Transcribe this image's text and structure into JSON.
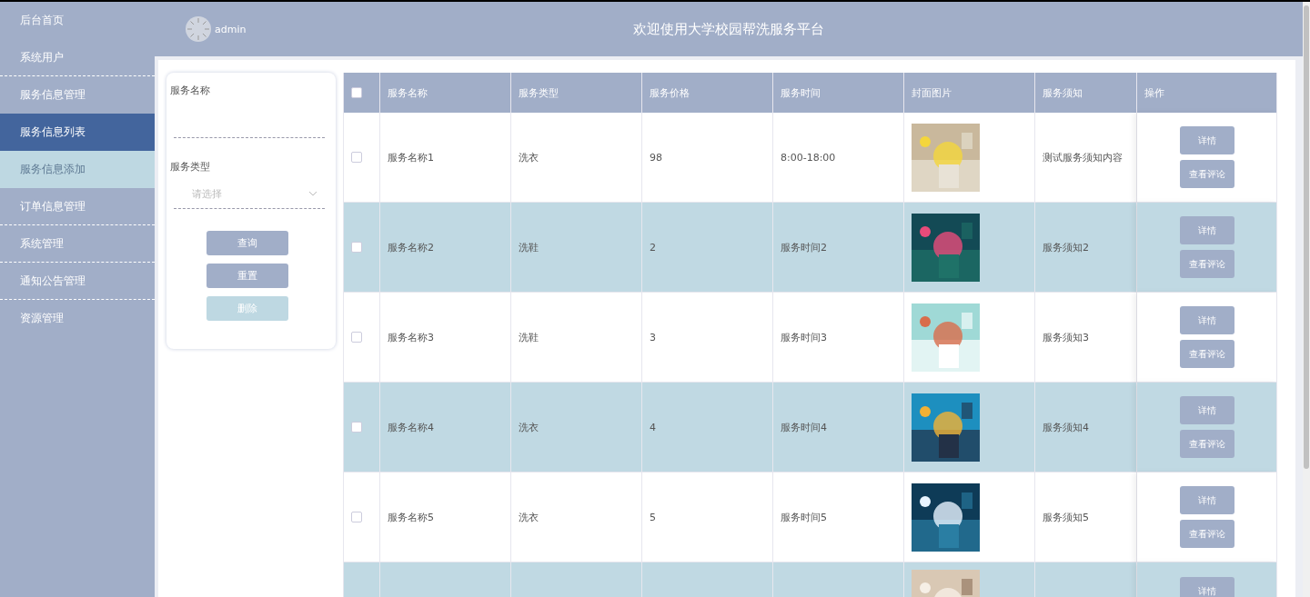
{
  "sidebar": {
    "items": [
      {
        "label": "后台首页",
        "kind": "item",
        "selected": false,
        "divider": false
      },
      {
        "label": "系统用户",
        "kind": "item",
        "selected": false,
        "divider": true
      },
      {
        "label": "服务信息管理",
        "kind": "item",
        "selected": false,
        "divider": false
      },
      {
        "label": "服务信息列表",
        "kind": "sub",
        "selected": true,
        "divider": false
      },
      {
        "label": "服务信息添加",
        "kind": "sub",
        "selected": false,
        "divider": false
      },
      {
        "label": "订单信息管理",
        "kind": "item",
        "selected": false,
        "divider": true
      },
      {
        "label": "系统管理",
        "kind": "item",
        "selected": false,
        "divider": true
      },
      {
        "label": "通知公告管理",
        "kind": "item",
        "selected": false,
        "divider": true
      },
      {
        "label": "资源管理",
        "kind": "item",
        "selected": false,
        "divider": false
      }
    ]
  },
  "header": {
    "user": "admin",
    "title": "欢迎使用大学校园帮洗服务平台"
  },
  "search": {
    "fields": [
      {
        "label": "服务名称",
        "kind": "input"
      },
      {
        "label": "服务类型",
        "kind": "select",
        "placeholder": "请选择"
      }
    ],
    "buttons": [
      {
        "label": "查询",
        "disabled": false
      },
      {
        "label": "重置",
        "disabled": false
      },
      {
        "label": "删除",
        "disabled": true
      }
    ]
  },
  "table": {
    "select_all": {
      "checked": false
    },
    "columns": [
      "服务名称",
      "服务类型",
      "服务价格",
      "服务时间",
      "封面图片",
      "服务须知",
      "操作"
    ],
    "rows": [
      {
        "checked": false,
        "cells": [
          "服务名称1",
          "洗衣",
          "98",
          "8:00-18:00",
          "测试服务须知内容"
        ],
        "picture": {
          "kind": "picture"
        },
        "actions": [
          "详情",
          "查看评论"
        ]
      },
      {
        "checked": false,
        "cells": [
          "服务名称2",
          "洗鞋",
          "2",
          "服务时间2",
          "服务须知2"
        ],
        "picture": {
          "kind": "picture"
        },
        "actions": [
          "详情",
          "查看评论"
        ]
      },
      {
        "checked": false,
        "cells": [
          "服务名称3",
          "洗鞋",
          "3",
          "服务时间3",
          "服务须知3"
        ],
        "picture": {
          "kind": "picture"
        },
        "actions": [
          "详情",
          "查看评论"
        ]
      },
      {
        "checked": false,
        "cells": [
          "服务名称4",
          "洗衣",
          "4",
          "服务时间4",
          "服务须知4"
        ],
        "picture": {
          "kind": "picture"
        },
        "actions": [
          "详情",
          "查看评论"
        ]
      },
      {
        "checked": false,
        "cells": [
          "服务名称5",
          "洗衣",
          "5",
          "服务时间5",
          "服务须知5"
        ],
        "picture": {
          "kind": "picture"
        },
        "actions": [
          "详情",
          "查看评论"
        ]
      },
      {
        "picture": {
          "kind": "picture"
        },
        "actions": [
          "详情"
        ]
      }
    ]
  }
}
